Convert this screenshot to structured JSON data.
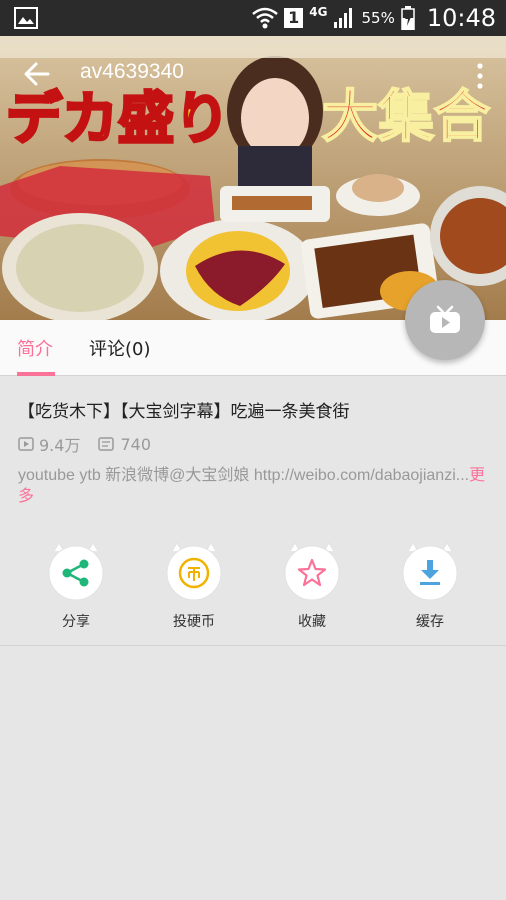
{
  "status_bar": {
    "battery": "55%",
    "time": "10:48",
    "network": "4G",
    "sim_slot": "1"
  },
  "header": {
    "title": "av4639340"
  },
  "hero": {
    "overlay_text_left": "デカ盛り",
    "overlay_text_right": "大集合"
  },
  "tabs": [
    {
      "label": "简介",
      "active": true
    },
    {
      "label": "评论(0)",
      "active": false
    }
  ],
  "video": {
    "title": "【吃货木下】【大宝剑字幕】吃遍一条美食街",
    "views": "9.4万",
    "danmaku": "740",
    "description": "youtube ytb  新浪微博@大宝剑娘 http://weibo.com/dabaojianzi...",
    "more_label": "更多"
  },
  "actions": [
    {
      "label": "分享",
      "icon": "share-icon",
      "color": "#1fb67a"
    },
    {
      "label": "投硬币",
      "icon": "coin-icon",
      "color": "#f0b400"
    },
    {
      "label": "收藏",
      "icon": "star-icon",
      "color": "#fb7299"
    },
    {
      "label": "缓存",
      "icon": "download-icon",
      "color": "#4da3e0"
    }
  ],
  "colors": {
    "accent": "#fb7299",
    "background": "#e6e6e6"
  }
}
